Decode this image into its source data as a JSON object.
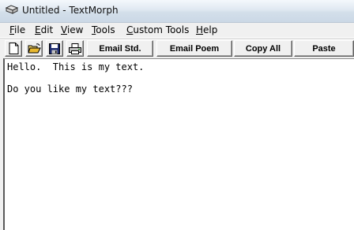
{
  "window": {
    "title": "Untitled - TextMorph",
    "icon": "textmorph-app-icon"
  },
  "menu": [
    {
      "label": "File",
      "accel": "F",
      "rest": "ile"
    },
    {
      "label": "Edit",
      "accel": "E",
      "rest": "dit"
    },
    {
      "label": "View",
      "accel": "V",
      "rest": "iew"
    },
    {
      "label": "Tools",
      "accel": "T",
      "rest": "ools"
    },
    {
      "label": "Custom Tools",
      "accel": "C",
      "rest": "ustom Tools"
    },
    {
      "label": "Help",
      "accel": "H",
      "rest": "elp"
    }
  ],
  "toolbar": {
    "icons": [
      "new-document-icon",
      "open-folder-icon",
      "save-disk-icon",
      "print-icon"
    ],
    "email_std_label": "Email Std.",
    "email_poem_label": "Email Poem",
    "copy_all_label": "Copy All",
    "paste_label": "Paste"
  },
  "editor": {
    "text": "Hello.  This is my text.\n\nDo you like my text???"
  }
}
